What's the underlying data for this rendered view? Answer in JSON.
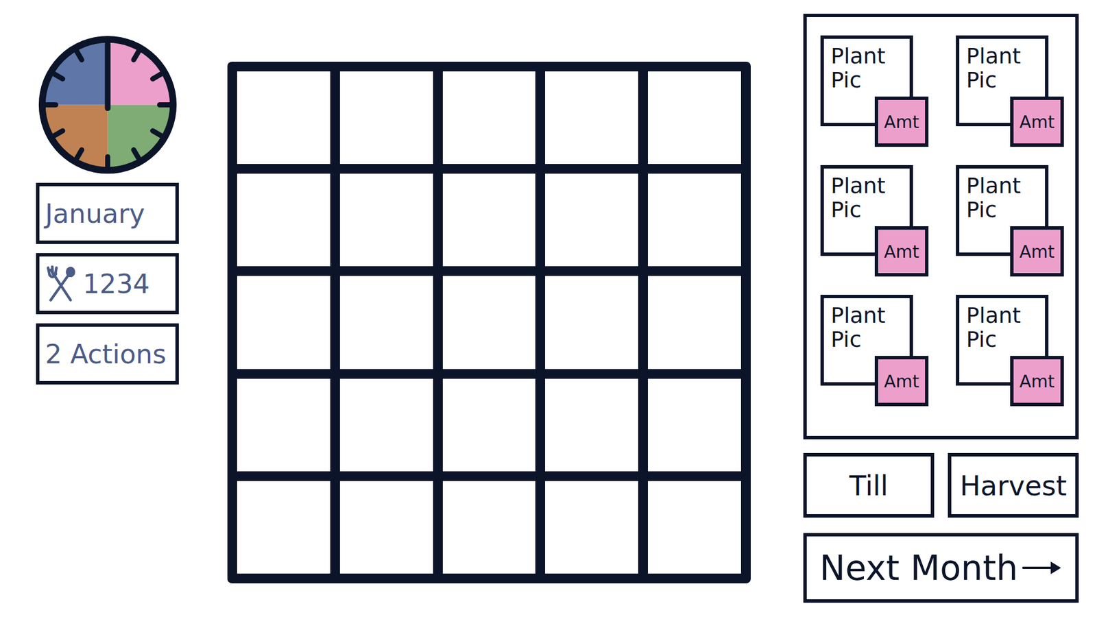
{
  "clock": {
    "quarters": [
      {
        "color": "#ec9fcb"
      },
      {
        "color": "#7fab74"
      },
      {
        "color": "#c08252"
      },
      {
        "color": "#5f77a8"
      }
    ]
  },
  "status": {
    "month": "January",
    "food": "1234",
    "actions": "2 Actions"
  },
  "field": {
    "rows": 5,
    "columns": 5
  },
  "plants": [
    {
      "label": "Plant Pic",
      "amount": "Amt"
    },
    {
      "label": "Plant Pic",
      "amount": "Amt"
    },
    {
      "label": "Plant Pic",
      "amount": "Amt"
    },
    {
      "label": "Plant Pic",
      "amount": "Amt"
    },
    {
      "label": "Plant Pic",
      "amount": "Amt"
    },
    {
      "label": "Plant Pic",
      "amount": "Amt"
    }
  ],
  "buttons": {
    "till": "Till",
    "harvest": "Harvest",
    "next": "Next Month"
  }
}
